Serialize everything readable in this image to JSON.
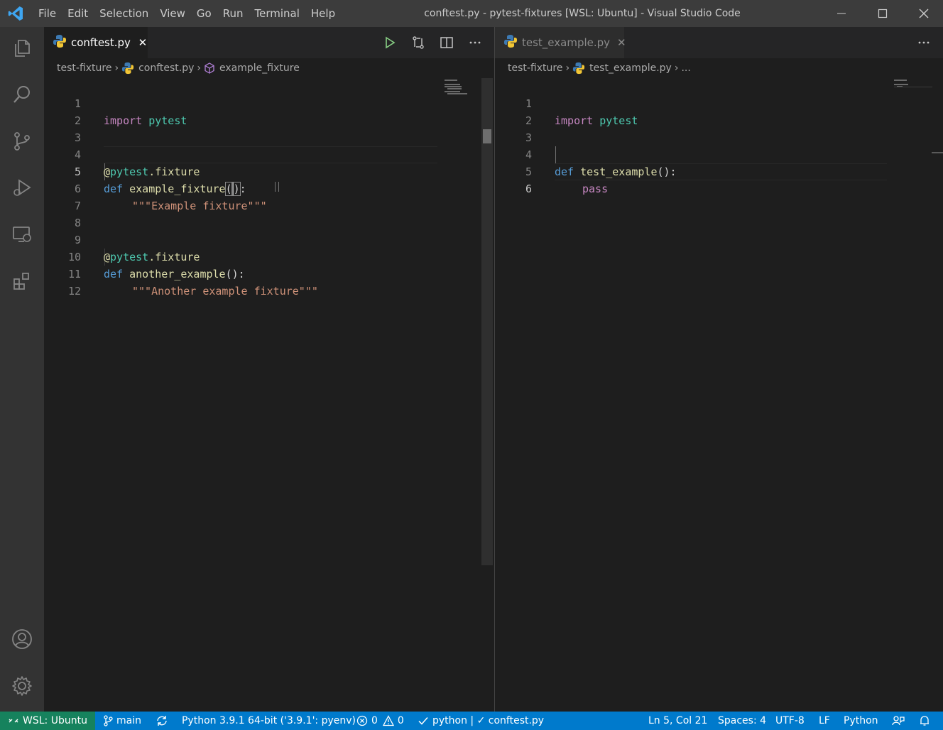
{
  "window": {
    "title": "conftest.py - pytest-fixtures [WSL: Ubuntu] - Visual Studio Code"
  },
  "menu": [
    "File",
    "Edit",
    "Selection",
    "View",
    "Go",
    "Run",
    "Terminal",
    "Help"
  ],
  "colors": {
    "accent": "#007acc",
    "remote": "#16825d",
    "keyword_import": "#c586c0",
    "module": "#4ec9b0",
    "function": "#dcdcaa",
    "keyword_def": "#569cd6",
    "string": "#ce9178"
  },
  "activity_bar": {
    "items": [
      "explorer-icon",
      "search-icon",
      "source-control-icon",
      "run-debug-icon",
      "remote-explorer-icon",
      "extensions-icon"
    ],
    "bottom": [
      "account-icon",
      "manage-gear-icon"
    ]
  },
  "left_editor": {
    "tab": {
      "label": "conftest.py",
      "icon": "python-file-icon",
      "close": "✕"
    },
    "actions": [
      "run-icon",
      "compare-changes-icon",
      "split-editor-icon",
      "more-actions-icon"
    ],
    "breadcrumb": {
      "folder": "test-fixture",
      "file": "conftest.py",
      "symbol": "example_fixture"
    },
    "line_numbers": [
      "1",
      "2",
      "3",
      "4",
      "5",
      "6",
      "7",
      "8",
      "9",
      "10",
      "11",
      "12"
    ],
    "current_line": "5",
    "lines": {
      "l1_import": "import",
      "l1_module": "pytest",
      "l4_at": "@",
      "l4_module": "pytest",
      "l4_attr": ".fixture",
      "l5_def": "def",
      "l5_name": "example_fixture",
      "l5_paren_open": "(",
      "l5_paren_close": ")",
      "l5_colon": ":",
      "l6_doc": "\"\"\"Example fixture\"\"\"",
      "l9_at": "@",
      "l9_module": "pytest",
      "l9_attr": ".fixture",
      "l10_def": "def",
      "l10_name": "another_example",
      "l10_sig": "():",
      "l11_doc": "\"\"\"Another example fixture\"\"\""
    }
  },
  "right_editor": {
    "tab": {
      "label": "test_example.py",
      "icon": "python-file-icon",
      "close": "✕"
    },
    "actions": [
      "more-actions-icon"
    ],
    "breadcrumb": {
      "folder": "test-fixture",
      "file": "test_example.py",
      "more": "..."
    },
    "line_numbers": [
      "1",
      "2",
      "3",
      "4",
      "5",
      "6"
    ],
    "current_line": "6",
    "lines": {
      "l1_import": "import",
      "l1_module": "pytest",
      "l4_def": "def",
      "l4_name": "test_example",
      "l4_sig": "():",
      "l5_pass": "pass"
    }
  },
  "status_bar": {
    "remote": "WSL: Ubuntu",
    "branch": "main",
    "interpreter": "Python 3.9.1 64-bit ('3.9.1': pyenv)",
    "errors": "0",
    "warnings": "0",
    "tests": "python | ✓ conftest.py",
    "position": "Ln 5, Col 21",
    "spaces": "Spaces: 4",
    "encoding": "UTF-8",
    "eol": "LF",
    "language": "Python"
  }
}
